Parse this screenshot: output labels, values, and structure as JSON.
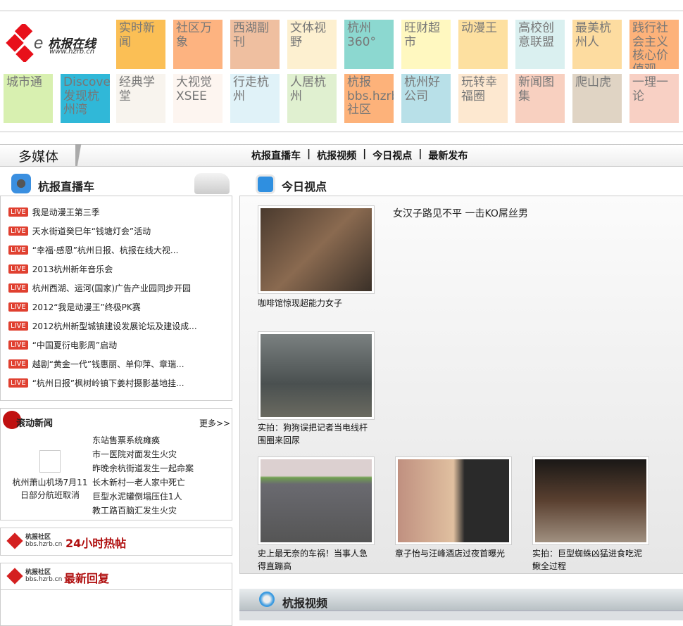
{
  "logo": {
    "name": "杭报在线",
    "url_text": "www.hzrb.cn"
  },
  "tiles_row1": [
    {
      "label": "实时新闻",
      "color": "#fbbf55"
    },
    {
      "label": "社区万象",
      "color": "#fdb380"
    },
    {
      "label": "西湖副刊",
      "color": "#efbfa0"
    },
    {
      "label": "文体视野",
      "color": "#fdf0d0"
    },
    {
      "label": "杭州360°",
      "color": "#8cd8d0"
    },
    {
      "label": "旺财超市",
      "color": "#fff8c0"
    },
    {
      "label": "动漫王",
      "color": "#fde0a0"
    },
    {
      "label": "高校创意联盟",
      "color": "#daf0f0"
    },
    {
      "label": "最美杭州人",
      "color": "#fddca0"
    },
    {
      "label": "践行社会主义核心价值观",
      "color": "#fdb27a"
    }
  ],
  "tiles_row2": [
    {
      "label": "城市通",
      "color": "#d8f0b0"
    },
    {
      "label": "Discovery发现杭州湾",
      "color": "#30b8d8"
    },
    {
      "label": "经典学堂",
      "color": "#f8f4ee"
    },
    {
      "label": "大视觉XSEE",
      "color": "#fdf5f0"
    },
    {
      "label": "行走杭州",
      "color": "#e0f2f8"
    },
    {
      "label": "人居杭州",
      "color": "#e0f0d0"
    },
    {
      "label": "杭报bbs.hzrb.cn社区",
      "color": "#fdb27a"
    },
    {
      "label": "杭州好公司",
      "color": "#b8e0e8"
    },
    {
      "label": "玩转幸福圈",
      "color": "#fde8d0"
    },
    {
      "label": "新闻图集",
      "color": "#f8d0c0"
    },
    {
      "label": "爬山虎",
      "color": "#e0d4c4"
    },
    {
      "label": "一理一论",
      "color": "#f8d0c4"
    }
  ],
  "section": {
    "title": "多媒体",
    "nav": [
      "杭报直播车",
      "|",
      "杭报视频",
      "|",
      "今日视点",
      "|",
      "最新发布"
    ]
  },
  "live": {
    "title": "杭报直播车",
    "badge": "LIVE",
    "items": [
      "我是动漫王第三季",
      "天水街道癸巳年“钱塘灯会”活动",
      "“幸福·感恩”杭州日报、杭报在线大视...",
      "2013杭州新年音乐会",
      "杭州西湖、运河(国家)广告产业园同步开园",
      "2012“我是动漫王”终极PK赛",
      "2012杭州新型城镇建设发展论坛及建设成...",
      "“中国夏衍电影周”启动",
      "越剧“黄金一代”钱惠丽、单仰萍、章瑞...",
      "“杭州日报”枫树岭镇下姜村摄影基地挂..."
    ]
  },
  "rolling": {
    "title": "滚动新闻",
    "more": "更多>>",
    "photo_caption": "杭州萧山机场7月11日部分航班取消",
    "items": [
      "东站售票系统瘫痪",
      "市一医院对面发生火灾",
      "昨晚余杭街道发生一起命案",
      "长木新村一老人家中死亡",
      "巨型水泥罐倒塌压住1人",
      "教工路百脑汇发生火灾"
    ]
  },
  "bbs": {
    "logo_name": "杭报社区",
    "logo_url": "bbs.hzrb.cn",
    "hot": "24小时热帖",
    "reply": "最新回复"
  },
  "today": {
    "title": "今日视点",
    "headline": "女汉子路见不平 一击KO屌丝男",
    "items": [
      "咖啡馆惊现超能力女子",
      "实拍：狗狗误把记者当电线杆围圈来回尿",
      "史上最无奈的车祸！当事人急得直蹦高",
      "章子怡与汪峰酒店过夜首曝光",
      "实拍：巨型蜘蛛凶猛进食吃泥鳅全过程"
    ]
  },
  "video": {
    "title": "杭报视频"
  }
}
